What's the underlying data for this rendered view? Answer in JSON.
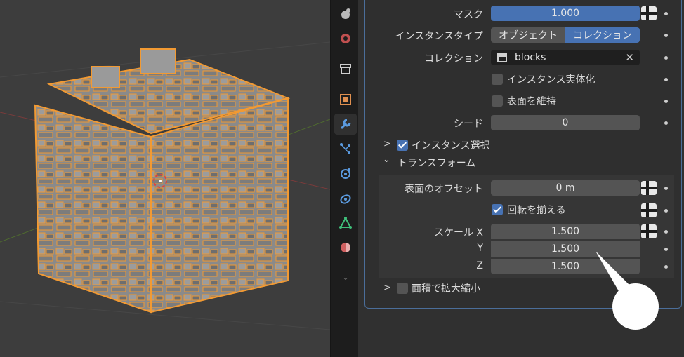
{
  "props": {
    "mask": {
      "label": "マスク",
      "value": "1.000"
    },
    "instance_type": {
      "label": "インスタンスタイプ",
      "options": [
        "オブジェクト",
        "コレクション"
      ],
      "selected": "コレクション"
    },
    "collection": {
      "label": "コレクション",
      "value": "blocks"
    },
    "realize": {
      "label": "インスタンス実体化",
      "checked": false
    },
    "keep_surface": {
      "label": "表面を維持",
      "checked": false
    },
    "seed": {
      "label": "シード",
      "value": "0"
    },
    "instance_select": {
      "label": "インスタンス選択",
      "checked": true
    },
    "transform": {
      "title": "トランスフォーム",
      "offset": {
        "label": "表面のオフセット",
        "value": "0 m"
      },
      "align_rotation": {
        "label": "回転を揃える",
        "checked": true
      },
      "scale_x": {
        "label": "スケール X",
        "value": "1.500"
      },
      "scale_y": {
        "label": "Y",
        "value": "1.500"
      },
      "scale_z": {
        "label": "Z",
        "value": "1.500"
      }
    },
    "scale_by_area": {
      "label": "面積で拡大縮小",
      "checked": false
    }
  },
  "tabs": [
    "world-icon",
    "scene-icon",
    "collection-box-icon",
    "object-icon",
    "wrench-modifier-icon",
    "particles-icon",
    "physics-icon",
    "constraints-icon",
    "data-triangle-icon",
    "material-icon"
  ],
  "active_tab": "wrench-modifier-icon",
  "colors": {
    "accent": "#4772b3",
    "selection_outline": "#f29a33",
    "panel_bg": "#303030"
  }
}
